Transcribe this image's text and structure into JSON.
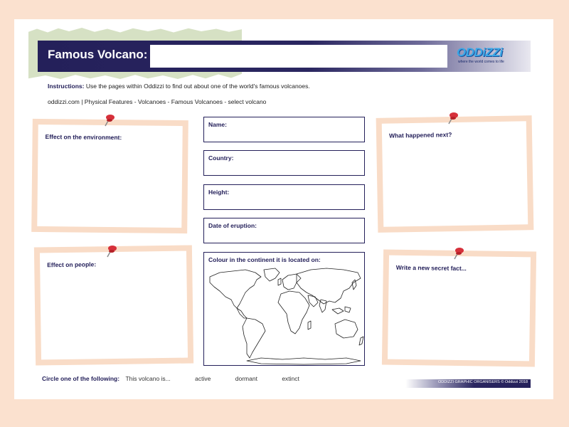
{
  "header": {
    "title": "Famous Volcano:",
    "title_value": ""
  },
  "logo": {
    "name": "ODDiZZi",
    "tagline": "where the world comes to life"
  },
  "instructions": {
    "label": "Instructions:",
    "text": " Use the pages within Oddizzi to find out about one of the world's famous volcanoes."
  },
  "path": "oddizzi.com | Physical Features - Volcanoes - Famous Volcanoes - select volcano",
  "notes": {
    "environment": "Effect on the environment:",
    "people": "Effect on people:",
    "next": "What happened next?",
    "secret": "Write a new secret fact..."
  },
  "fields": {
    "name": "Name:",
    "country": "Country:",
    "height": "Height:",
    "eruption": "Date of eruption:"
  },
  "map": {
    "label": "Colour in the continent it is located on:"
  },
  "circle": {
    "label": "Circle one of the following:",
    "prompt": "This volcano is...",
    "options": [
      "active",
      "dormant",
      "extinct"
    ]
  },
  "footer": "ODDIZZI GRAPHIC ORGANISERS © Oddizzi 2018",
  "colors": {
    "navy": "#24205a",
    "peach": "#f9dcc7",
    "pin": "#d6303a",
    "torn_paper": "#d6e1c4"
  }
}
